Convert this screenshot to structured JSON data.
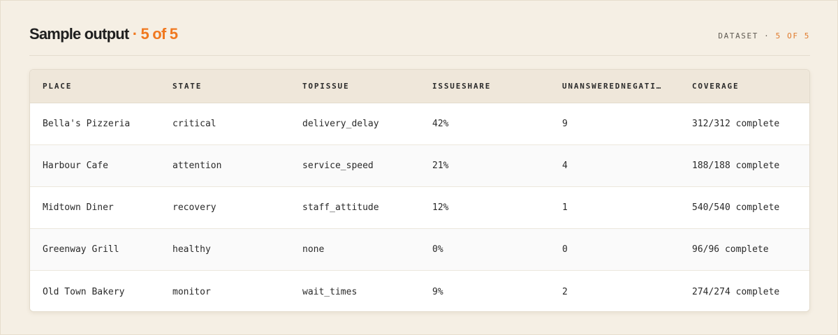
{
  "header": {
    "title": "Sample output",
    "title_accent": "· 5 of 5",
    "dataset_label": "DATASET ·",
    "dataset_accent": "5 OF 5"
  },
  "colors": {
    "accent": "#f0781f",
    "background": "#f5efe4",
    "header_row": "#efe7da"
  },
  "table": {
    "columns": [
      "PLACE",
      "STATE",
      "TOPISSUE",
      "ISSUESHARE",
      "UNANSWEREDNEGATI…",
      "COVERAGE"
    ],
    "rows": [
      [
        "Bella's Pizzeria",
        "critical",
        "delivery_delay",
        "42%",
        "9",
        "312/312 complete"
      ],
      [
        "Harbour Cafe",
        "attention",
        "service_speed",
        "21%",
        "4",
        "188/188 complete"
      ],
      [
        "Midtown Diner",
        "recovery",
        "staff_attitude",
        "12%",
        "1",
        "540/540 complete"
      ],
      [
        "Greenway Grill",
        "healthy",
        "none",
        "0%",
        "0",
        "96/96 complete"
      ],
      [
        "Old Town Bakery",
        "monitor",
        "wait_times",
        "9%",
        "2",
        "274/274 complete"
      ]
    ]
  }
}
